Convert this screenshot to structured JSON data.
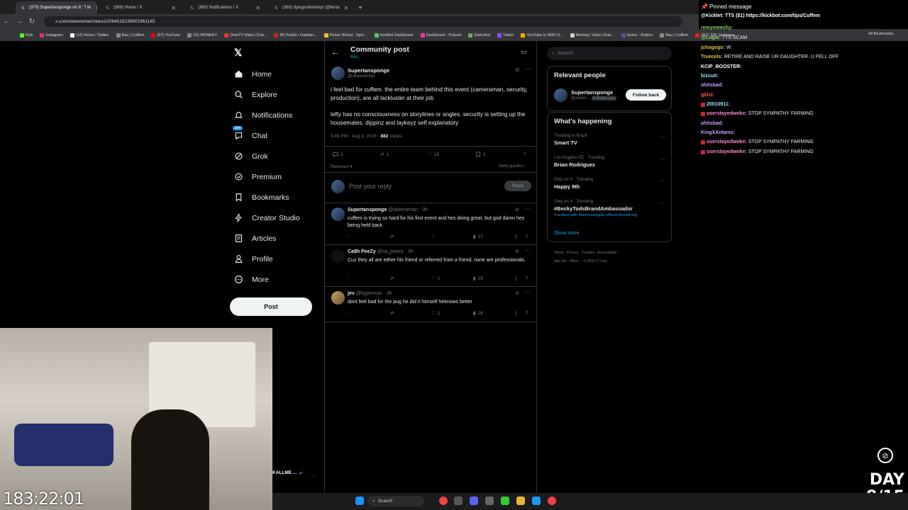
{
  "browser": {
    "tabs": [
      {
        "label": "(370) Supertansponge on X: \"i fe",
        "active": true
      },
      {
        "label": "(369) Home / X",
        "active": false
      },
      {
        "label": "(369) Notifications / X",
        "active": false
      },
      {
        "label": "(369) dyingonfentanyl (@fenta",
        "active": false
      }
    ],
    "url": "x.com/skeenertan/status/2084516235601961145",
    "bookmarks": [
      "Kick",
      "Instagram",
      "(12) Home / Twitter",
      "Bau | Cuffem",
      "(57) YouTube",
      "OG MONKEY",
      "OmeTV Video Chat...",
      "IRLToolkit • Dashbo...",
      "Picker Wheel - Spin...",
      "KickBot Dashboard",
      "Dashboard - Pulsoid",
      "DistroKid",
      "Twitch",
      "YouTube to WAV D...",
      "Monkey: Video Chat...",
      "Home - Roblox",
      "Bau | Cuffem",
      "UFC 326: Holloway..."
    ],
    "all_bookmarks": "All Bookmarks"
  },
  "nav": {
    "items": [
      "Home",
      "Explore",
      "Notifications",
      "Chat",
      "Grok",
      "Premium",
      "Bookmarks",
      "Creator Studio",
      "Articles",
      "Profile",
      "More"
    ],
    "chat_badge": "20+",
    "post_label": "Post"
  },
  "header": {
    "title": "Community post",
    "subtitle": "BAU"
  },
  "post": {
    "name": "Supertansponge",
    "handle": "@skeenertan",
    "text1": "i feel bad for cuffem. the entire team behind this event (cameraman, security, production), are all lackluster at their job",
    "text2": "lefty has no consciousness on storylines or angles. security is setting up the housemates. dippinz and laykeyz self explanatory",
    "time": "9:46 PM · Aug 3, 2026 · ",
    "views_count": "882",
    "views_label": " Views",
    "replies": "3",
    "reposts": "1",
    "likes": "15",
    "bookmarks": "1",
    "sort": "Relevant",
    "view_quotes": "View quotes"
  },
  "compose": {
    "placeholder": "Post your reply",
    "button": "Reply"
  },
  "replies": [
    {
      "name": "Supertansponge",
      "meta": "@skeenertan · 3h",
      "text": "cuffem is trying so hard for his first event and hes doing great. but god damn hes being held back",
      "likes": "",
      "views": "37"
    },
    {
      "name": "Ca$h PeeZy",
      "meta": "@ca_peezy · 3h",
      "text": "Cuz they all are either his friend or referred from a friend, none are professionals.",
      "likes": "1",
      "views": "29"
    },
    {
      "name": "jev",
      "meta": "@hyperoxic · 3h",
      "text": "dont feel bad for the pug he did it himself heknows better",
      "likes": "1",
      "views": "28"
    }
  ],
  "search": {
    "placeholder": "Search"
  },
  "relevant": {
    "title": "Relevant people",
    "name": "Supertansponge",
    "handle": "@skeen...",
    "follows": "Follows you",
    "button": "Follow back"
  },
  "happening": {
    "title": "What's happening",
    "trends": [
      {
        "context": "Trending in Brazil",
        "name": "Smart TV",
        "extra": ""
      },
      {
        "context": "Los Angeles FC · Trending",
        "name": "Brian Rodriguez",
        "extra": ""
      },
      {
        "context": "Only on X · Trending",
        "name": "Happy 9th",
        "extra": ""
      },
      {
        "context": "Only on X · Trending",
        "name": "#BeckyTodsBrandAmbassador",
        "extra": "Trending with #beckysangels, #BeckyArmstrong"
      }
    ],
    "show_more": "Show more"
  },
  "footer": {
    "line1": "Terms · Privacy · Cookies · Accessibility ·",
    "line2": "Ads info · More ··· © 2026 X Corp."
  },
  "chat": {
    "pinned": "Pinned message",
    "pinned_msg": "@Kicklet: TTS ($1) https://kickbot.com/tips/Cuffem",
    "lines": [
      {
        "user": "remymeechy:",
        "msg": "",
        "color": "#8fd16b"
      },
      {
        "user": "@Lugie:",
        "msg": "TTS SCAM",
        "color": "#8fd16b"
      },
      {
        "user": "jchogogo:",
        "msg": "W",
        "color": "#e0c341"
      },
      {
        "user": "Truecels:",
        "msg": "RETIRE AND RAISE UR DAUGHTER. U FELL OFF",
        "color": "#e0c341"
      },
      {
        "user": "KCIP_BOOSTER:",
        "msg": "",
        "color": "#fff"
      },
      {
        "user": "bizcuit:",
        "msg": "",
        "color": "#9be3ff"
      },
      {
        "user": "ohitsbad:",
        "msg": "",
        "color": "#c4a0ff"
      },
      {
        "user": "gblst:",
        "msg": "",
        "color": "#ff5555"
      },
      {
        "user": "20010911:",
        "msg": "",
        "color": "#9be3ff"
      },
      {
        "user": "userstayedwoke:",
        "msg": "STOP SYMPATHY FARMING",
        "color": "#ff88cc"
      },
      {
        "user": "ohitsbad:",
        "msg": "",
        "color": "#c4a0ff"
      },
      {
        "user": "KingXAntarez:",
        "msg": "",
        "color": "#c4a0ff"
      },
      {
        "user": "userstayedwoke:",
        "msg": "STOP SYMPATHY FARMING",
        "color": "#ff88cc"
      },
      {
        "user": "userstayedwoke:",
        "msg": "STOP SYMPATHY FARMING",
        "color": "#ff88cc"
      }
    ]
  },
  "stream": {
    "timer": "183:22:01",
    "day_label": "DAY",
    "day_count": "8/15",
    "cam_name": "KALLME ..."
  },
  "taskbar": {
    "search": "Search"
  }
}
